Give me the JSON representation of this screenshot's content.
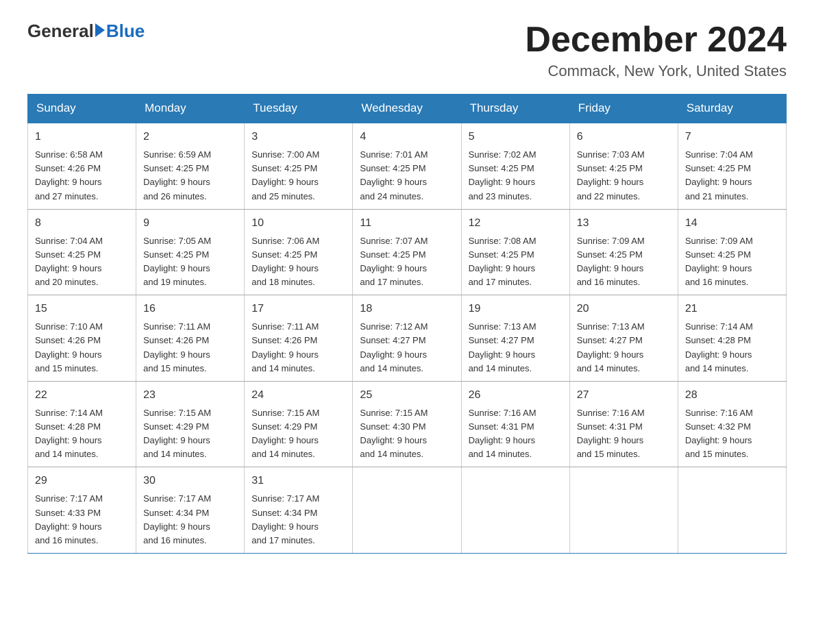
{
  "logo": {
    "general": "General",
    "blue": "Blue"
  },
  "title": "December 2024",
  "subtitle": "Commack, New York, United States",
  "days_header": [
    "Sunday",
    "Monday",
    "Tuesday",
    "Wednesday",
    "Thursday",
    "Friday",
    "Saturday"
  ],
  "weeks": [
    [
      {
        "num": "1",
        "sunrise": "6:58 AM",
        "sunset": "4:26 PM",
        "daylight": "9 hours and 27 minutes."
      },
      {
        "num": "2",
        "sunrise": "6:59 AM",
        "sunset": "4:25 PM",
        "daylight": "9 hours and 26 minutes."
      },
      {
        "num": "3",
        "sunrise": "7:00 AM",
        "sunset": "4:25 PM",
        "daylight": "9 hours and 25 minutes."
      },
      {
        "num": "4",
        "sunrise": "7:01 AM",
        "sunset": "4:25 PM",
        "daylight": "9 hours and 24 minutes."
      },
      {
        "num": "5",
        "sunrise": "7:02 AM",
        "sunset": "4:25 PM",
        "daylight": "9 hours and 23 minutes."
      },
      {
        "num": "6",
        "sunrise": "7:03 AM",
        "sunset": "4:25 PM",
        "daylight": "9 hours and 22 minutes."
      },
      {
        "num": "7",
        "sunrise": "7:04 AM",
        "sunset": "4:25 PM",
        "daylight": "9 hours and 21 minutes."
      }
    ],
    [
      {
        "num": "8",
        "sunrise": "7:04 AM",
        "sunset": "4:25 PM",
        "daylight": "9 hours and 20 minutes."
      },
      {
        "num": "9",
        "sunrise": "7:05 AM",
        "sunset": "4:25 PM",
        "daylight": "9 hours and 19 minutes."
      },
      {
        "num": "10",
        "sunrise": "7:06 AM",
        "sunset": "4:25 PM",
        "daylight": "9 hours and 18 minutes."
      },
      {
        "num": "11",
        "sunrise": "7:07 AM",
        "sunset": "4:25 PM",
        "daylight": "9 hours and 17 minutes."
      },
      {
        "num": "12",
        "sunrise": "7:08 AM",
        "sunset": "4:25 PM",
        "daylight": "9 hours and 17 minutes."
      },
      {
        "num": "13",
        "sunrise": "7:09 AM",
        "sunset": "4:25 PM",
        "daylight": "9 hours and 16 minutes."
      },
      {
        "num": "14",
        "sunrise": "7:09 AM",
        "sunset": "4:25 PM",
        "daylight": "9 hours and 16 minutes."
      }
    ],
    [
      {
        "num": "15",
        "sunrise": "7:10 AM",
        "sunset": "4:26 PM",
        "daylight": "9 hours and 15 minutes."
      },
      {
        "num": "16",
        "sunrise": "7:11 AM",
        "sunset": "4:26 PM",
        "daylight": "9 hours and 15 minutes."
      },
      {
        "num": "17",
        "sunrise": "7:11 AM",
        "sunset": "4:26 PM",
        "daylight": "9 hours and 14 minutes."
      },
      {
        "num": "18",
        "sunrise": "7:12 AM",
        "sunset": "4:27 PM",
        "daylight": "9 hours and 14 minutes."
      },
      {
        "num": "19",
        "sunrise": "7:13 AM",
        "sunset": "4:27 PM",
        "daylight": "9 hours and 14 minutes."
      },
      {
        "num": "20",
        "sunrise": "7:13 AM",
        "sunset": "4:27 PM",
        "daylight": "9 hours and 14 minutes."
      },
      {
        "num": "21",
        "sunrise": "7:14 AM",
        "sunset": "4:28 PM",
        "daylight": "9 hours and 14 minutes."
      }
    ],
    [
      {
        "num": "22",
        "sunrise": "7:14 AM",
        "sunset": "4:28 PM",
        "daylight": "9 hours and 14 minutes."
      },
      {
        "num": "23",
        "sunrise": "7:15 AM",
        "sunset": "4:29 PM",
        "daylight": "9 hours and 14 minutes."
      },
      {
        "num": "24",
        "sunrise": "7:15 AM",
        "sunset": "4:29 PM",
        "daylight": "9 hours and 14 minutes."
      },
      {
        "num": "25",
        "sunrise": "7:15 AM",
        "sunset": "4:30 PM",
        "daylight": "9 hours and 14 minutes."
      },
      {
        "num": "26",
        "sunrise": "7:16 AM",
        "sunset": "4:31 PM",
        "daylight": "9 hours and 14 minutes."
      },
      {
        "num": "27",
        "sunrise": "7:16 AM",
        "sunset": "4:31 PM",
        "daylight": "9 hours and 15 minutes."
      },
      {
        "num": "28",
        "sunrise": "7:16 AM",
        "sunset": "4:32 PM",
        "daylight": "9 hours and 15 minutes."
      }
    ],
    [
      {
        "num": "29",
        "sunrise": "7:17 AM",
        "sunset": "4:33 PM",
        "daylight": "9 hours and 16 minutes."
      },
      {
        "num": "30",
        "sunrise": "7:17 AM",
        "sunset": "4:34 PM",
        "daylight": "9 hours and 16 minutes."
      },
      {
        "num": "31",
        "sunrise": "7:17 AM",
        "sunset": "4:34 PM",
        "daylight": "9 hours and 17 minutes."
      },
      null,
      null,
      null,
      null
    ]
  ],
  "labels": {
    "sunrise": "Sunrise:",
    "sunset": "Sunset:",
    "daylight": "Daylight:"
  }
}
